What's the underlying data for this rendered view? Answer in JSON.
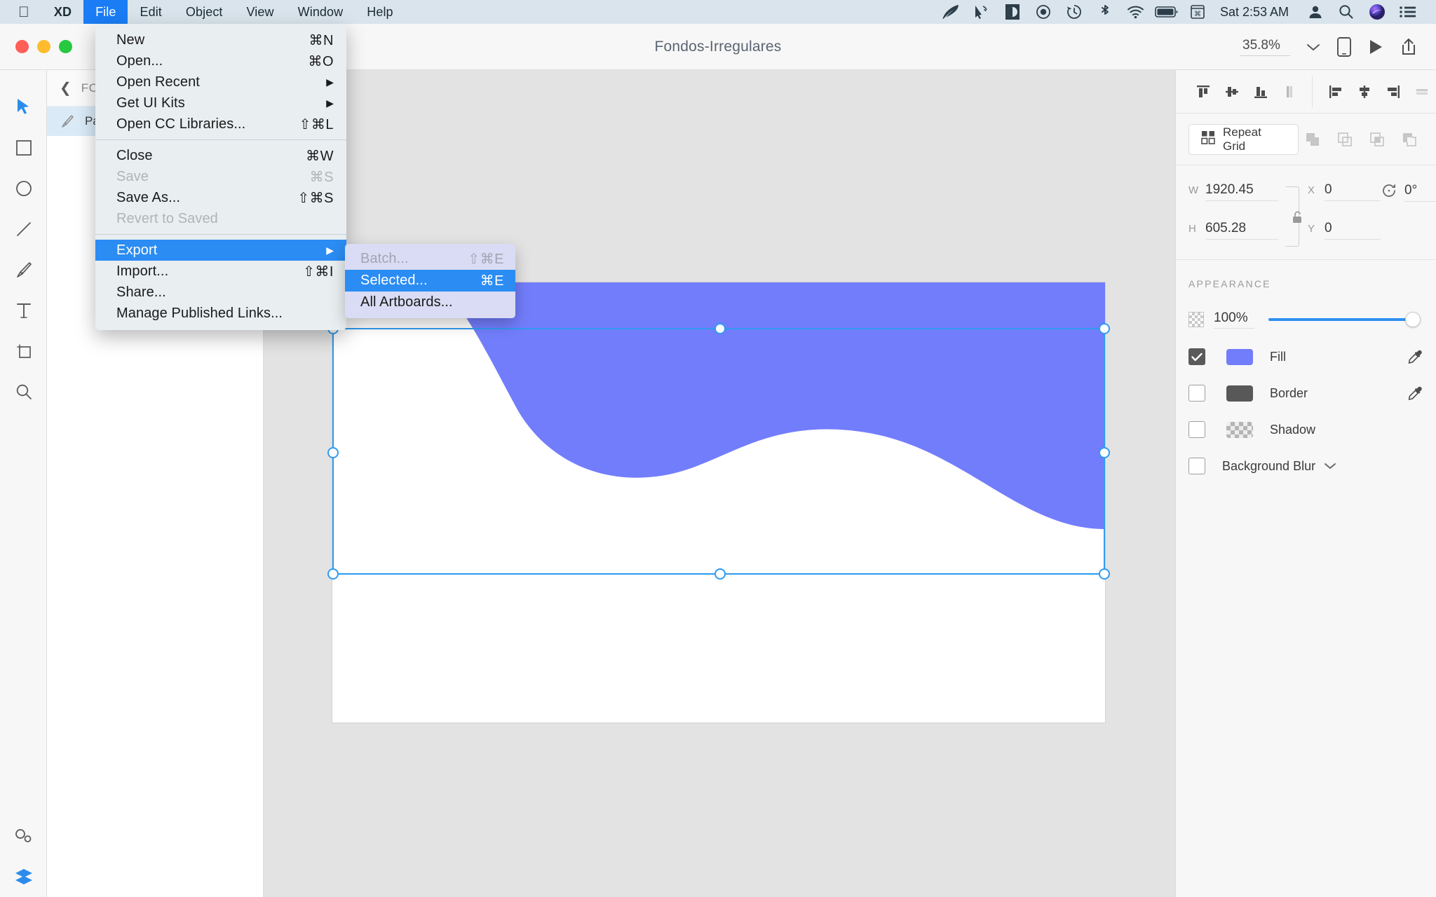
{
  "menubar": {
    "apple_icon": "apple-logo-icon",
    "items": [
      {
        "label": "XD",
        "bold": true,
        "active": false
      },
      {
        "label": "File",
        "bold": false,
        "active": true
      },
      {
        "label": "Edit",
        "bold": false,
        "active": false
      },
      {
        "label": "Object",
        "bold": false,
        "active": false
      },
      {
        "label": "View",
        "bold": false,
        "active": false
      },
      {
        "label": "Window",
        "bold": false,
        "active": false
      },
      {
        "label": "Help",
        "bold": false,
        "active": false
      }
    ],
    "status_icons": [
      "feather-icon",
      "cursor-signal-icon",
      "contrast-icon",
      "record-icon",
      "time-machine-icon",
      "bluetooth-icon",
      "wifi-icon",
      "battery-icon",
      "keyboard-input-icon"
    ],
    "clock": "Sat 2:53 AM",
    "trailing_icons": [
      "user-icon",
      "search-icon",
      "siri-icon",
      "control-center-icon"
    ]
  },
  "titlebar": {
    "document_title": "Fondos-Irregulares",
    "zoom_level": "35.8%",
    "dropdown_icon": "chevron-down-icon",
    "actions": [
      "device-preview-icon",
      "play-preview-icon",
      "share-export-icon"
    ]
  },
  "toolbar": {
    "tools": [
      {
        "name": "select-tool",
        "icon": "cursor-arrow-icon",
        "selected": true
      },
      {
        "name": "rectangle-tool",
        "icon": "square-icon",
        "selected": false
      },
      {
        "name": "ellipse-tool",
        "icon": "circle-icon",
        "selected": false
      },
      {
        "name": "line-tool",
        "icon": "line-icon",
        "selected": false
      },
      {
        "name": "pen-tool",
        "icon": "pen-nib-icon",
        "selected": false
      },
      {
        "name": "text-tool",
        "icon": "text-t-icon",
        "selected": false
      },
      {
        "name": "artboard-tool",
        "icon": "artboard-icon",
        "selected": false
      },
      {
        "name": "zoom-tool",
        "icon": "magnifier-icon",
        "selected": false
      }
    ],
    "bottom_tools": [
      {
        "name": "assets-panel-toggle",
        "icon": "assets-icon",
        "selected": false
      },
      {
        "name": "layers-panel-toggle",
        "icon": "layers-stack-icon",
        "selected": true
      }
    ]
  },
  "layers_panel": {
    "back_icon": "chevron-left-icon",
    "breadcrumb": "FO",
    "layer": {
      "icon": "pen-path-icon",
      "label": "Pa"
    }
  },
  "right_panel": {
    "align_vertical": [
      "align-top-icon",
      "align-middle-icon",
      "align-bottom-icon",
      "distribute-horizontal-icon"
    ],
    "align_horizontal": [
      "align-left-icon",
      "align-center-icon",
      "align-right-icon",
      "distribute-vertical-icon"
    ],
    "repeat_grid": {
      "label": "Repeat Grid",
      "icon": "grid-4-icon"
    },
    "boolean_ops": [
      "add-shape-icon",
      "subtract-shape-icon",
      "intersect-shape-icon",
      "exclude-shape-icon"
    ],
    "properties": {
      "w_label": "W",
      "w_value": "1920.45",
      "h_label": "H",
      "h_value": "605.28",
      "x_label": "X",
      "x_value": "0",
      "y_label": "Y",
      "y_value": "0",
      "rotation_icon": "rotate-icon",
      "rotation_value": "0°",
      "lock_icon": "unlocked-icon"
    },
    "appearance": {
      "title": "APPEARANCE",
      "opacity_icon": "opacity-checker-icon",
      "opacity_value": "100%",
      "slider_percent": 100,
      "rows": [
        {
          "name": "fill",
          "label": "Fill",
          "checked": true,
          "swatch": "#727dfc",
          "eyedropper": true
        },
        {
          "name": "border",
          "label": "Border",
          "checked": false,
          "swatch": "#585858",
          "eyedropper": true
        },
        {
          "name": "shadow",
          "label": "Shadow",
          "checked": false,
          "swatch": "checker",
          "eyedropper": false
        }
      ],
      "background_blur": {
        "label": "Background Blur",
        "checked": false,
        "chevron": "chevron-down-icon"
      }
    }
  },
  "file_menu": {
    "items": [
      {
        "label": "New",
        "key": "⌘N",
        "disabled": false,
        "submenu": false,
        "highlight": false
      },
      {
        "label": "Open...",
        "key": "⌘O",
        "disabled": false,
        "submenu": false,
        "highlight": false
      },
      {
        "label": "Open Recent",
        "key": "",
        "disabled": false,
        "submenu": true,
        "highlight": false
      },
      {
        "label": "Get UI Kits",
        "key": "",
        "disabled": false,
        "submenu": true,
        "highlight": false
      },
      {
        "label": "Open CC Libraries...",
        "key": "⇧⌘L",
        "disabled": false,
        "submenu": false,
        "highlight": false
      },
      {
        "separator": true
      },
      {
        "label": "Close",
        "key": "⌘W",
        "disabled": false,
        "submenu": false,
        "highlight": false
      },
      {
        "label": "Save",
        "key": "⌘S",
        "disabled": true,
        "submenu": false,
        "highlight": false
      },
      {
        "label": "Save As...",
        "key": "⇧⌘S",
        "disabled": false,
        "submenu": false,
        "highlight": false
      },
      {
        "label": "Revert to Saved",
        "key": "",
        "disabled": true,
        "submenu": false,
        "highlight": false
      },
      {
        "separator": true
      },
      {
        "label": "Export",
        "key": "",
        "disabled": false,
        "submenu": true,
        "highlight": true
      },
      {
        "label": "Import...",
        "key": "⇧⌘I",
        "disabled": false,
        "submenu": false,
        "highlight": false
      },
      {
        "label": "Share...",
        "key": "",
        "disabled": false,
        "submenu": false,
        "highlight": false
      },
      {
        "label": "Manage Published Links...",
        "key": "",
        "disabled": false,
        "submenu": false,
        "highlight": false
      }
    ]
  },
  "export_submenu": {
    "items": [
      {
        "label": "Batch...",
        "key": "⇧⌘E",
        "disabled": true,
        "highlight": false
      },
      {
        "label": "Selected...",
        "key": "⌘E",
        "disabled": false,
        "highlight": true
      },
      {
        "label": "All Artboards...",
        "key": "",
        "disabled": false,
        "highlight": false
      }
    ]
  },
  "canvas": {
    "background_color": "#e3e3e3",
    "artboard_color": "#ffffff",
    "shape": {
      "name": "purple-wave-shape",
      "fill": "#727dfc",
      "selected": true,
      "selection_color": "#2f9bf2"
    }
  }
}
